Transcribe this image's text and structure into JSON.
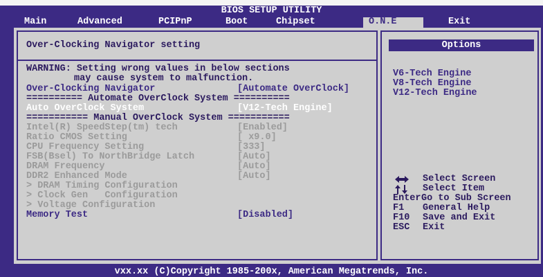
{
  "header": {
    "title": "BIOS SETUP UTILITY",
    "tabs": [
      {
        "label": "Main",
        "selected": false
      },
      {
        "label": "Advanced",
        "selected": false
      },
      {
        "label": "PCIPnP",
        "selected": false
      },
      {
        "label": "Boot",
        "selected": false
      },
      {
        "label": "Chipset",
        "selected": false
      },
      {
        "label": "O.N.E",
        "selected": true
      },
      {
        "label": "Exit",
        "selected": false
      }
    ]
  },
  "main": {
    "section_title": "Over-Clocking Navigator setting",
    "warning_line1": "WARNING: Setting wrong values in below sections",
    "warning_line2": "may cause system to malfunction.",
    "items": [
      {
        "label": "Over-Clocking Navigator",
        "value": "[Automate OverClock]",
        "state": "normal"
      },
      {
        "label": "========== Automate OverClock System ==========",
        "value": "",
        "state": "divider"
      },
      {
        "label": "Auto OverClock System",
        "value": "[V12-Tech Engine]",
        "state": "highlighted"
      },
      {
        "label": "=========== Manual OverClock System ===========",
        "value": "",
        "state": "divider"
      },
      {
        "label": "Intel(R) SpeedStep(tm) tech",
        "value": "[Enabled]",
        "state": "disabled"
      },
      {
        "label": "Ratio CMOS Setting",
        "value": "[ x9.0]",
        "state": "disabled"
      },
      {
        "label": "CPU Frequency Setting",
        "value": "[333]",
        "state": "disabled"
      },
      {
        "label": "FSB(Bsel) To NorthBridge Latch",
        "value": "[Auto]",
        "state": "disabled"
      },
      {
        "label": "DRAM Frequency",
        "value": "[Auto]",
        "state": "disabled"
      },
      {
        "label": "DDR2 Enhanced Mode",
        "value": "[Auto]",
        "state": "disabled"
      },
      {
        "label": "> DRAM Timing Configuration",
        "value": "",
        "state": "disabled"
      },
      {
        "label": "> Clock Gen   Configuration",
        "value": "",
        "state": "disabled"
      },
      {
        "label": "> Voltage Configuration",
        "value": "",
        "state": "disabled"
      },
      {
        "label": "Memory Test",
        "value": "[Disabled]",
        "state": "normal"
      }
    ]
  },
  "options": {
    "title": "Options",
    "items": [
      "V6-Tech Engine",
      "V8-Tech Engine",
      "V12-Tech Engine"
    ]
  },
  "help": {
    "keys": [
      {
        "key": "",
        "action": "Select Screen",
        "icon": "left-right-arrows-icon"
      },
      {
        "key": "",
        "action": "Select Item",
        "icon": "up-down-arrows-icon"
      },
      {
        "key": "Enter",
        "action": "Go to Sub Screen",
        "icon": ""
      },
      {
        "key": "F1",
        "action": "General Help",
        "icon": ""
      },
      {
        "key": "F10",
        "action": "Save and Exit",
        "icon": ""
      },
      {
        "key": "ESC",
        "action": "Exit",
        "icon": ""
      }
    ]
  },
  "footer": {
    "text": "vxx.xx (C)Copyright 1985-200x, American Megatrends, Inc."
  },
  "colors": {
    "frame_blue": "#3c2a84",
    "panel_grey": "#cfcfcf",
    "disabled_text": "#9b9b9b",
    "highlight_text": "#ffffff"
  }
}
